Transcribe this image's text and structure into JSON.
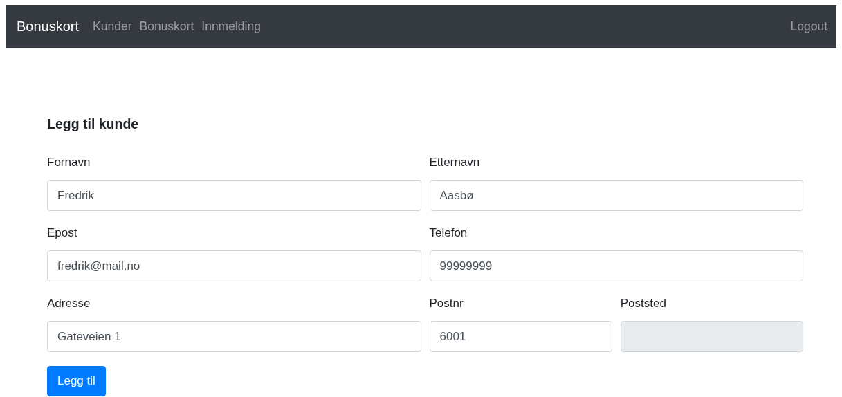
{
  "navbar": {
    "brand": "Bonuskort",
    "links": [
      {
        "label": "Kunder"
      },
      {
        "label": "Bonuskort"
      },
      {
        "label": "Innmelding"
      }
    ],
    "logout": "Logout"
  },
  "form": {
    "title": "Legg til kunde",
    "rows": [
      [
        {
          "label": "Fornavn",
          "value": "Fredrik",
          "disabled": false
        },
        {
          "label": "Etternavn",
          "value": "Aasbø",
          "disabled": false
        }
      ],
      [
        {
          "label": "Epost",
          "value": "fredrik@mail.no",
          "disabled": false
        },
        {
          "label": "Telefon",
          "value": "99999999",
          "disabled": false
        }
      ],
      [
        {
          "label": "Adresse",
          "value": "Gateveien 1",
          "disabled": false
        },
        {
          "label": "Postnr",
          "value": "6001",
          "disabled": false
        },
        {
          "label": "Poststed",
          "disabled": true
        }
      ]
    ],
    "submit": "Legg til"
  }
}
